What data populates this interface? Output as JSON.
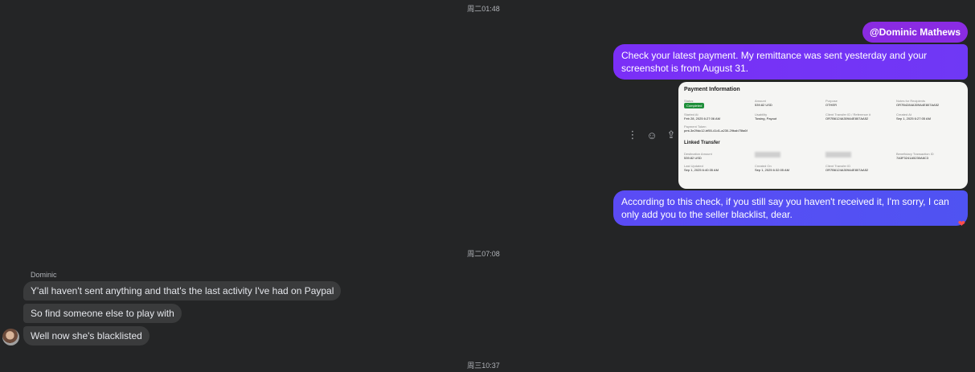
{
  "timestamps": [
    "周二01:48",
    "周二07:08",
    "周三10:37"
  ],
  "outgoing": {
    "mention": "@Dominic Mathews",
    "message1": "Check your latest payment. My remittance was sent yesterday and your screenshot is from August 31.",
    "message2": "According to this check, if you still say you haven't received it, I'm sorry, I can only add you to the seller blacklist, dear.",
    "reaction": "❤"
  },
  "actions": {
    "more": "⋮",
    "react": "☺",
    "share": "⇪"
  },
  "screenshot": {
    "title": "Payment Information",
    "fields": [
      {
        "label": "Status",
        "badge": "Completed"
      },
      {
        "label": "Amount",
        "value": "539.82 USD"
      },
      {
        "label": "Purpose",
        "value": "OTHER"
      },
      {
        "label": "Notes for Recipients",
        "value": "OR7B4284A309A4E807AA52"
      },
      {
        "label": "Started At",
        "value": "Feb 28, 2025 6:27:06 AM"
      },
      {
        "label": "Usability",
        "value": "Towing, Payout"
      },
      {
        "label": "Client Transfer ID / Reference #",
        "value": "OR7B6124A309A4E807AA52"
      },
      {
        "label": "Created At",
        "value": "Sep 1, 2025 6:27:05 AM"
      },
      {
        "label": "Payment Token",
        "value": "pmt-3e29dc12-bf55-41d1-a230-29bab75fa6f"
      }
    ],
    "linked_title": "Linked Transfer",
    "linked_fields": [
      {
        "label": "Destination Amount",
        "value": "539.82 USD"
      },
      {
        "label": "",
        "blur": true
      },
      {
        "label": "",
        "blur": true
      },
      {
        "label": "Beneficiary Transaction ID",
        "value": "7A3F3241A5230A6C3"
      },
      {
        "label": "Last Updated",
        "value": "Sep 1, 2025 6:40:35 AM"
      },
      {
        "label": "Created On",
        "value": "Sep 1, 2025 6:32:05 AM"
      },
      {
        "label": "Client Transfer ID",
        "value": "OR7B6124A309A4E807AA52"
      }
    ]
  },
  "incoming": {
    "sender": "Dominic",
    "messages": [
      "Y'all haven't sent anything and that's the last activity I've had on Paypal",
      "So find someone else to play with",
      "Well now she's blacklisted"
    ]
  },
  "colors": {
    "background": "#242526",
    "outgoing_bubble": "#7b2ff7",
    "incoming_bubble": "#3a3b3c"
  }
}
